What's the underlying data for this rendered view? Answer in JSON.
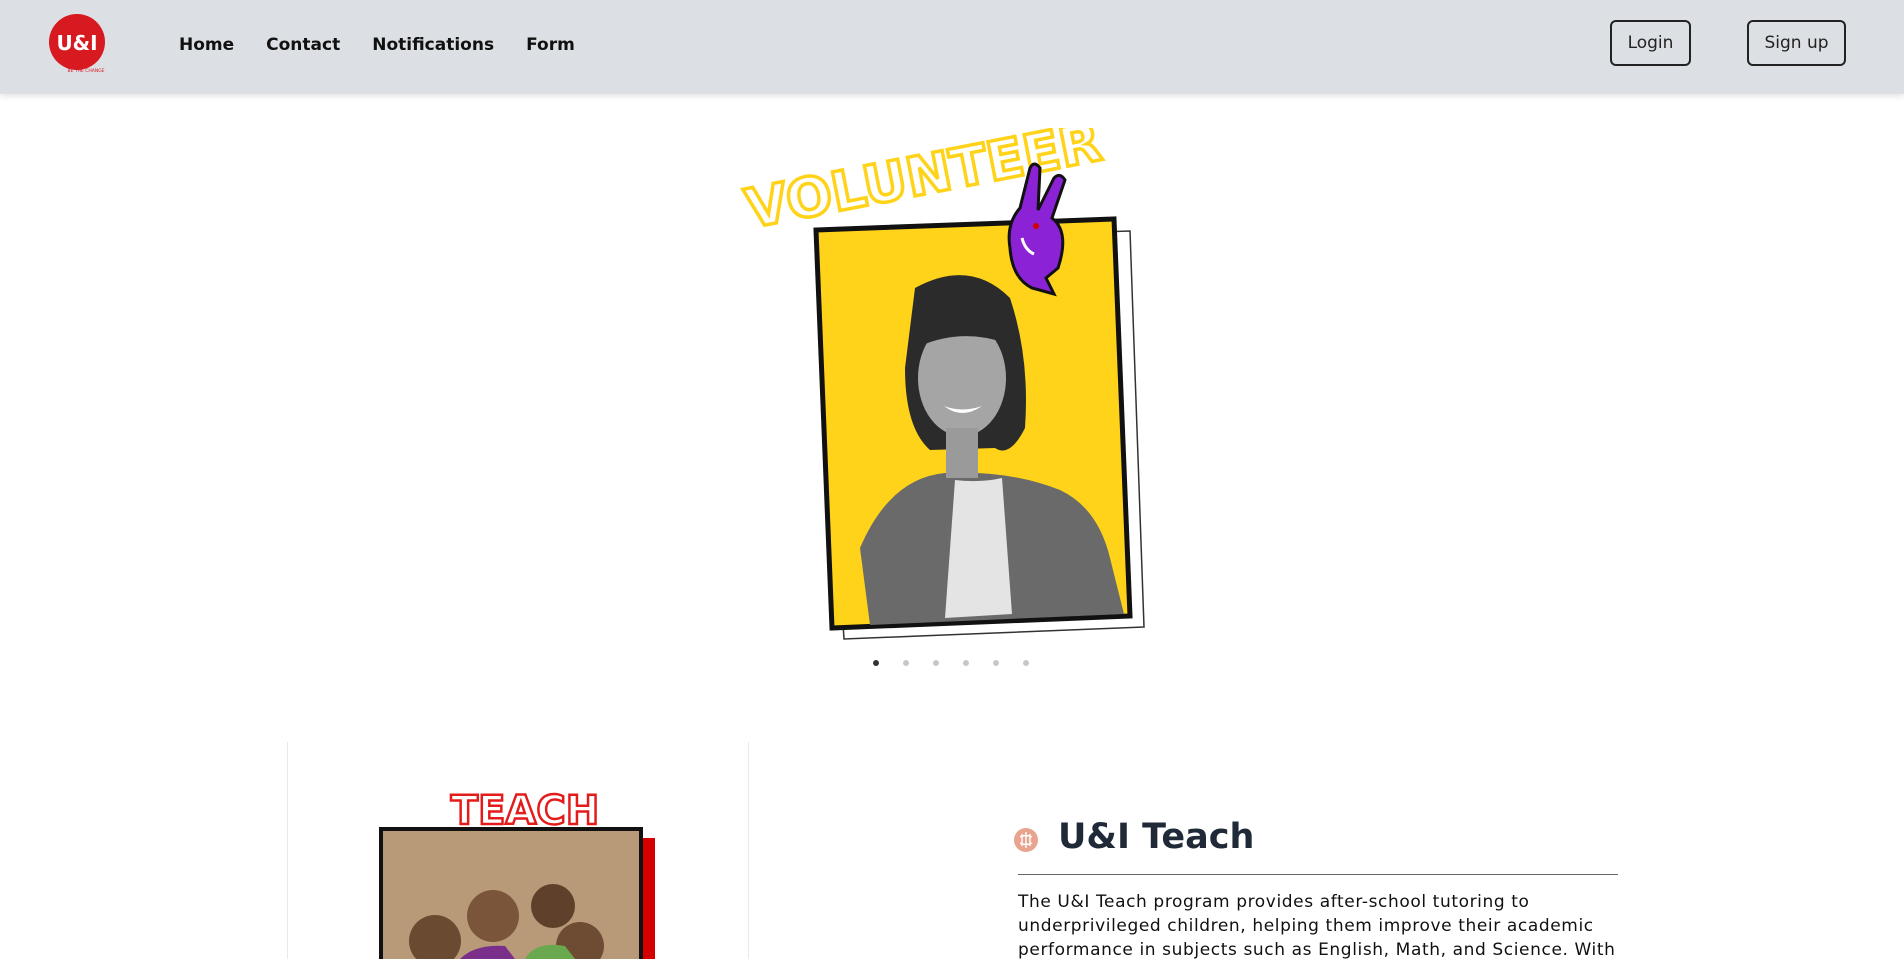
{
  "header": {
    "logo_text": "U&I",
    "logo_tagline": "BE THE CHANGE",
    "nav": [
      {
        "label": "Home"
      },
      {
        "label": "Contact"
      },
      {
        "label": "Notifications"
      },
      {
        "label": "Form"
      }
    ],
    "login_label": "Login",
    "signup_label": "Sign up"
  },
  "carousel": {
    "slide_heading": "VOLUNTEER",
    "slide_count": 6,
    "active_index": 0,
    "colors": {
      "accent": "#ffd31a",
      "heading": "#ffd31a",
      "hand": "#8b22d6"
    }
  },
  "program": {
    "image_heading": "TEACH",
    "icon": "brain-icon",
    "title": "U&I Teach",
    "description": "The U&I Teach program provides after-school tutoring to underprivileged children, helping them improve their academic performance in subjects such as English, Math, and Science. With",
    "colors": {
      "heading": "#e31b1b",
      "accent": "#d40000",
      "icon": "#e8a48f"
    }
  }
}
